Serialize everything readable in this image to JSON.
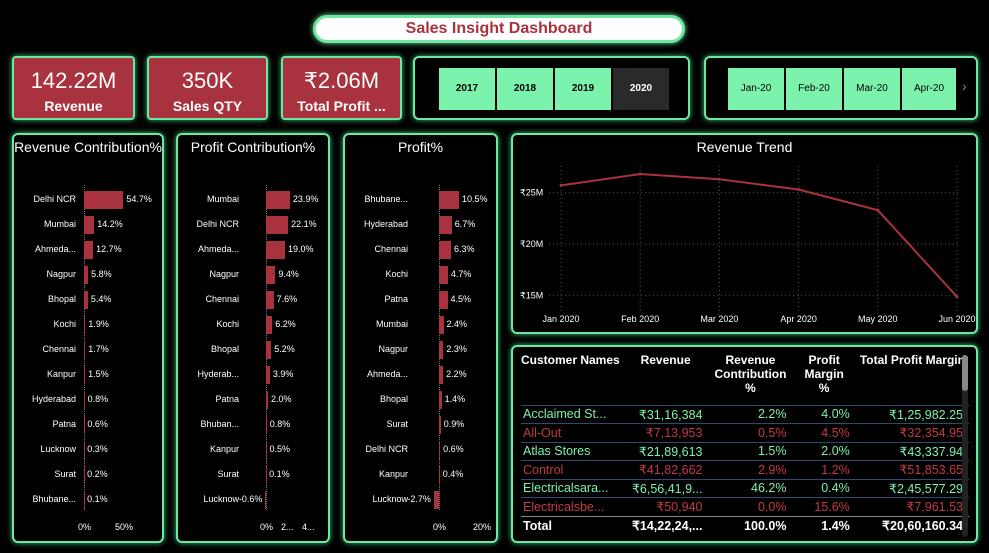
{
  "header": {
    "title": "Sales Insight Dashboard"
  },
  "kpis": [
    {
      "value": "142.22M",
      "label": "Revenue"
    },
    {
      "value": "350K",
      "label": "Sales QTY"
    },
    {
      "value": "₹2.06M",
      "label": "Total Profit ..."
    }
  ],
  "years": {
    "items": [
      "2017",
      "2018",
      "2019",
      "2020"
    ],
    "selected": "2020"
  },
  "months": {
    "items": [
      "Jan-20",
      "Feb-20",
      "Mar-20",
      "Apr-20"
    ],
    "next_icon": "chevron-right-icon"
  },
  "revenue_contribution": {
    "title": "Revenue Contribution%",
    "rows": [
      {
        "city": "Delhi NCR",
        "value": 54.7,
        "label": "54.7%"
      },
      {
        "city": "Mumbai",
        "value": 14.2,
        "label": "14.2%"
      },
      {
        "city": "Ahmeda...",
        "value": 12.7,
        "label": "12.7%"
      },
      {
        "city": "Nagpur",
        "value": 5.8,
        "label": "5.8%"
      },
      {
        "city": "Bhopal",
        "value": 5.4,
        "label": "5.4%"
      },
      {
        "city": "Kochi",
        "value": 1.9,
        "label": "1.9%"
      },
      {
        "city": "Chennai",
        "value": 1.7,
        "label": "1.7%"
      },
      {
        "city": "Kanpur",
        "value": 1.5,
        "label": "1.5%"
      },
      {
        "city": "Hyderabad",
        "value": 0.8,
        "label": "0.8%"
      },
      {
        "city": "Patna",
        "value": 0.6,
        "label": "0.6%"
      },
      {
        "city": "Lucknow",
        "value": 0.3,
        "label": "0.3%"
      },
      {
        "city": "Surat",
        "value": 0.2,
        "label": "0.2%"
      },
      {
        "city": "Bhubane...",
        "value": 0.1,
        "label": "0.1%"
      }
    ],
    "ticks": [
      "0%",
      "50%"
    ]
  },
  "profit_contribution": {
    "title": "Profit Contribution%",
    "rows": [
      {
        "city": "Mumbai",
        "value": 23.9,
        "label": "23.9%"
      },
      {
        "city": "Delhi NCR",
        "value": 22.1,
        "label": "22.1%"
      },
      {
        "city": "Ahmeda...",
        "value": 19.0,
        "label": "19.0%"
      },
      {
        "city": "Nagpur",
        "value": 9.4,
        "label": "9.4%"
      },
      {
        "city": "Chennai",
        "value": 7.6,
        "label": "7.6%"
      },
      {
        "city": "Kochi",
        "value": 6.2,
        "label": "6.2%"
      },
      {
        "city": "Bhopal",
        "value": 5.2,
        "label": "5.2%"
      },
      {
        "city": "Hyderab...",
        "value": 3.9,
        "label": "3.9%"
      },
      {
        "city": "Patna",
        "value": 2.0,
        "label": "2.0%"
      },
      {
        "city": "Bhuban...",
        "value": 0.8,
        "label": "0.8%"
      },
      {
        "city": "Kanpur",
        "value": 0.5,
        "label": "0.5%"
      },
      {
        "city": "Surat",
        "value": 0.1,
        "label": "0.1%"
      },
      {
        "city": "Lucknow",
        "value": -0.6,
        "label": "-0.6%"
      }
    ],
    "ticks": [
      "0%",
      "2...",
      "4..."
    ]
  },
  "profit_pct": {
    "title": "Profit%",
    "rows": [
      {
        "city": "Bhubane...",
        "value": 10.5,
        "label": "10.5%"
      },
      {
        "city": "Hyderabad",
        "value": 6.7,
        "label": "6.7%"
      },
      {
        "city": "Chennai",
        "value": 6.3,
        "label": "6.3%"
      },
      {
        "city": "Kochi",
        "value": 4.7,
        "label": "4.7%"
      },
      {
        "city": "Patna",
        "value": 4.5,
        "label": "4.5%"
      },
      {
        "city": "Mumbai",
        "value": 2.4,
        "label": "2.4%"
      },
      {
        "city": "Nagpur",
        "value": 2.3,
        "label": "2.3%"
      },
      {
        "city": "Ahmeda...",
        "value": 2.2,
        "label": "2.2%"
      },
      {
        "city": "Bhopal",
        "value": 1.4,
        "label": "1.4%"
      },
      {
        "city": "Surat",
        "value": 0.9,
        "label": "0.9%"
      },
      {
        "city": "Delhi NCR",
        "value": 0.6,
        "label": "0.6%"
      },
      {
        "city": "Kanpur",
        "value": 0.4,
        "label": "0.4%"
      },
      {
        "city": "Lucknow",
        "value": -2.7,
        "label": "-2.7%"
      }
    ],
    "ticks": [
      "0%",
      "20%"
    ]
  },
  "chart_data": {
    "type": "line",
    "title": "Revenue Trend",
    "x": [
      "Jan 2020",
      "Feb 2020",
      "Mar 2020",
      "Apr 2020",
      "May 2020",
      "Jun 2020"
    ],
    "series": [
      {
        "values": [
          25.7,
          26.8,
          26.3,
          25.3,
          23.3,
          14.9
        ]
      }
    ],
    "ylim": [
      14,
      27
    ],
    "yticks": [
      "₹25M",
      "₹20M",
      "₹15M"
    ],
    "ytick_values": [
      25,
      20,
      15
    ],
    "color": "#a8323e",
    "grid": true
  },
  "customers": {
    "headers": [
      "Customer Names",
      "Revenue",
      "Revenue Contribution %",
      "Profit Margin %",
      "Total Profit Margin"
    ],
    "rows": [
      {
        "name": "Acclaimed St...",
        "revenue": "₹31,16,384",
        "contrib": "2.2%",
        "margin": "4.0%",
        "total": "₹1,25,982.25",
        "status": "green"
      },
      {
        "name": "All-Out",
        "revenue": "₹7,13,953",
        "contrib": "0.5%",
        "margin": "4.5%",
        "total": "₹32,354.95",
        "status": "red"
      },
      {
        "name": "Atlas Stores",
        "revenue": "₹21,89,613",
        "contrib": "1.5%",
        "margin": "2.0%",
        "total": "₹43,337.94",
        "status": "green"
      },
      {
        "name": "Control",
        "revenue": "₹41,82,662",
        "contrib": "2.9%",
        "margin": "1.2%",
        "total": "₹51,853.65",
        "status": "red"
      },
      {
        "name": "Electricalsara...",
        "revenue": "₹6,56,41,9...",
        "contrib": "46.2%",
        "margin": "0.4%",
        "total": "₹2,45,577.29",
        "status": "green"
      },
      {
        "name": "Electricalsbe...",
        "revenue": "₹50,940",
        "contrib": "0.0%",
        "margin": "15.6%",
        "total": "₹7,961.53",
        "status": "red"
      }
    ],
    "total": {
      "name": "Total",
      "revenue": "₹14,22,24,...",
      "contrib": "100.0%",
      "margin": "1.4%",
      "total": "₹20,60,160.34"
    }
  }
}
